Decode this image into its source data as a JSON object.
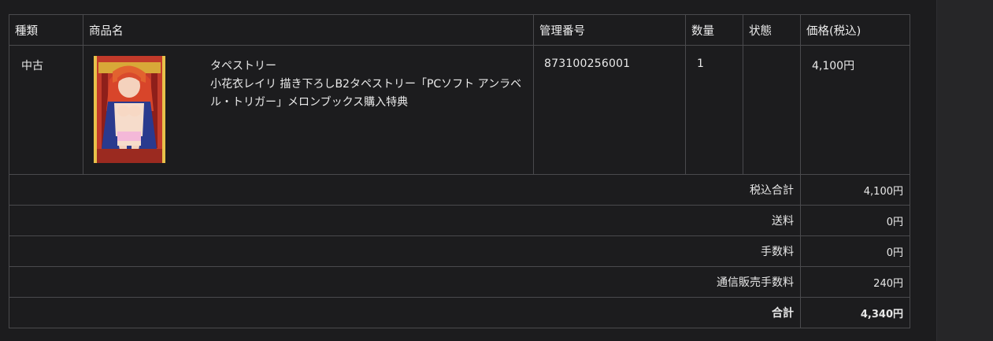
{
  "table": {
    "headers": {
      "type": "種類",
      "product": "商品名",
      "code": "管理番号",
      "qty": "数量",
      "state": "状態",
      "price": "価格(税込)"
    },
    "items": [
      {
        "type": "中古",
        "category": "タペストリー",
        "title": "小花衣レイリ 描き下ろしB2タペストリー「PCソフト アンラベル・トリガー」メロンブックス購入特典",
        "code": "873100256001",
        "qty": "1",
        "state": "",
        "price": "4,100円",
        "thumbnail_icon": "product-thumbnail-image"
      }
    ]
  },
  "totals": {
    "subtotal_label": "税込合計",
    "subtotal_value": "4,100円",
    "shipping_label": "送料",
    "shipping_value": "0円",
    "fee_label": "手数料",
    "fee_value": "0円",
    "mailorder_fee_label": "通信販売手数料",
    "mailorder_fee_value": "240円",
    "grand_total_label": "合計",
    "grand_total_value": "4,340円"
  },
  "colors": {
    "background": "#1c1c1e",
    "border": "#4a4a4d",
    "text": "#e8e8e8"
  }
}
